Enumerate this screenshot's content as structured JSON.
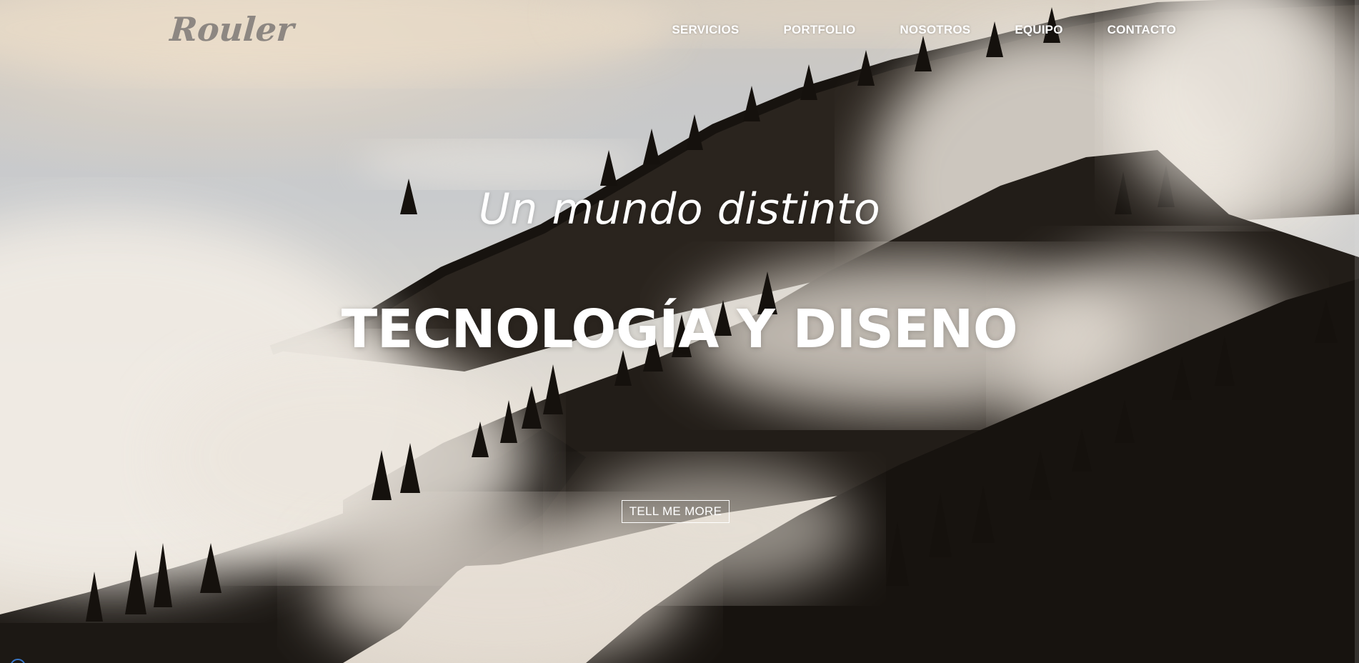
{
  "brand": {
    "logo_text": "Rouler"
  },
  "nav": {
    "items": [
      {
        "label": "SERVICIOS"
      },
      {
        "label": "PORTFOLIO"
      },
      {
        "label": "NOSOTROS"
      },
      {
        "label": "EQUIPO"
      },
      {
        "label": "CONTACTO"
      }
    ]
  },
  "hero": {
    "subheading": "Un mundo distinto",
    "heading": "TECNOLOGÍA Y DISENO",
    "cta_label": "TELL ME MORE",
    "background": "misty-forest-mountain-image"
  },
  "colors": {
    "text": "#ffffff",
    "logo": "#8d8782",
    "forest": "#1c1814"
  }
}
